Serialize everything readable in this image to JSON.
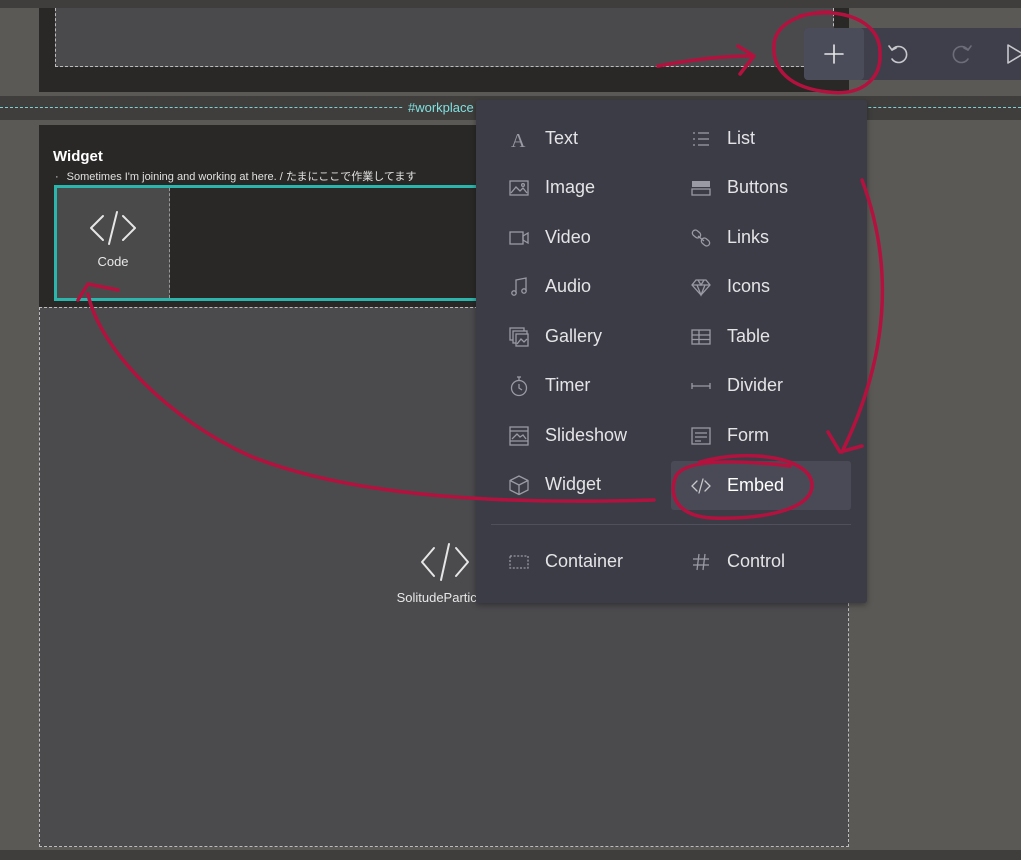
{
  "section_label": "#workplace",
  "widget": {
    "title": "Widget",
    "description": "Sometimes I'm joining and working at here. / たまにここで作業してます",
    "code_tile_label": "Code"
  },
  "embed_block_label": "SolitudeParticles",
  "toolbar": {
    "add_icon": "plus-icon",
    "undo_icon": "undo-icon",
    "redo_icon": "redo-icon",
    "preview_icon": "play-icon"
  },
  "menu": {
    "items": [
      {
        "label": "Text",
        "icon": "text-icon"
      },
      {
        "label": "List",
        "icon": "list-icon"
      },
      {
        "label": "Image",
        "icon": "image-icon"
      },
      {
        "label": "Buttons",
        "icon": "buttons-icon"
      },
      {
        "label": "Video",
        "icon": "video-icon"
      },
      {
        "label": "Links",
        "icon": "link-icon"
      },
      {
        "label": "Audio",
        "icon": "music-note-icon"
      },
      {
        "label": "Icons",
        "icon": "diamond-icon"
      },
      {
        "label": "Gallery",
        "icon": "gallery-icon"
      },
      {
        "label": "Table",
        "icon": "table-icon"
      },
      {
        "label": "Timer",
        "icon": "stopwatch-icon"
      },
      {
        "label": "Divider",
        "icon": "divider-icon"
      },
      {
        "label": "Slideshow",
        "icon": "slideshow-icon"
      },
      {
        "label": "Form",
        "icon": "form-icon"
      },
      {
        "label": "Widget",
        "icon": "cube-icon"
      },
      {
        "label": "Embed",
        "icon": "code-icon"
      }
    ],
    "footer": [
      {
        "label": "Container",
        "icon": "container-icon"
      },
      {
        "label": "Control",
        "icon": "hash-icon"
      }
    ],
    "active_item": "Embed"
  },
  "colors": {
    "annotation": "#b3123f",
    "accent_teal": "#2cb5ad",
    "menu_bg": "#3c3c47"
  }
}
